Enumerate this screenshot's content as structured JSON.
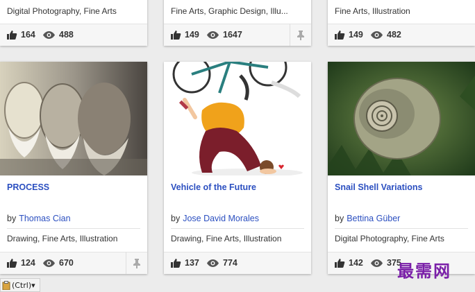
{
  "top_row": [
    {
      "tags": "Digital Photography, Fine Arts",
      "likes": "164",
      "views": "488",
      "pinned": false
    },
    {
      "tags": "Fine Arts, Graphic Design, Illu...",
      "likes": "149",
      "views": "1647",
      "pinned": true
    },
    {
      "tags": "Fine Arts, Illustration",
      "likes": "149",
      "views": "482",
      "pinned": false
    }
  ],
  "bottom_row": [
    {
      "title": "PROCESS",
      "by": "by",
      "author": "Thomas Cian",
      "tags": "Drawing, Fine Arts, Illustration",
      "likes": "124",
      "views": "670",
      "pinned": true
    },
    {
      "title": "Vehicle of the Future",
      "by": "by",
      "author": "Jose David Morales",
      "tags": "Drawing, Fine Arts, Illustration",
      "likes": "137",
      "views": "774",
      "pinned": false
    },
    {
      "title": "Snail Shell Variations",
      "by": "by",
      "author": "Bettina Güber",
      "tags": "Digital Photography, Fine Arts",
      "likes": "142",
      "views": "375",
      "pinned": false
    }
  ],
  "watermark": "最需网",
  "ctrl_badge": "(Ctrl)▾",
  "colors": {
    "link": "#2b4fc0",
    "watermark": "#7a1fa8"
  }
}
